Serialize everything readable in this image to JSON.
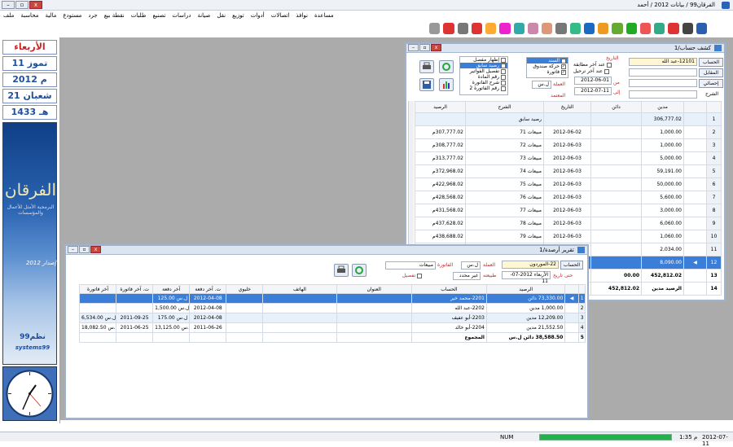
{
  "app": {
    "title": "الفرقان99 / بيانات 2012 / أحمد"
  },
  "window_buttons": {
    "close": "x",
    "restore": "▫",
    "min": "–"
  },
  "menu": [
    "ملف",
    "محاسبة",
    "مالية",
    "مستودع",
    "جرد",
    "نقطة بيع",
    "طلبات",
    "تصنيع",
    "دراسات",
    "صيانة",
    "نقل",
    "توزيع",
    "أدوات",
    "اتصالات",
    "نوافذ",
    "مساعدة"
  ],
  "sidebar": {
    "day": "الأربعاء",
    "greg_month": "11 تموز",
    "greg_year": "2012 م",
    "hijri_month": "21 شعبان",
    "hijri_year": "1433 هـ",
    "logo": "الفرقان",
    "logo_sub": "البرمجية الأمثل للأعمال والمؤسسات",
    "edition": "إصدار 2012",
    "sys_ar": "نظم99",
    "sys_en": "systems99"
  },
  "colors": {
    "accent": "#3b7ed8",
    "brand": "#1f4f9a",
    "alert": "#c1272d",
    "progress": "#23b14d"
  },
  "status": {
    "num": "NUM",
    "time": "1:35 م",
    "date": "2012-07-11",
    "progress_percent": 100
  },
  "account_statement": {
    "title": "كشف حساب/1",
    "account_label": "الحساب",
    "account_value": "12101-عبد الله",
    "counter_label": "المقابل",
    "stats_label": "إحصائي",
    "desc_label": "الشرح",
    "date_section": "التاريخ",
    "opt_match": "عند آخر مطابقة",
    "opt_transfer": "عند آخر ترحيل",
    "from_label": "من",
    "from_date": "2012-06-01",
    "to_label": "إلى",
    "to_date": "2012-07-11",
    "currency_label": "العملة",
    "currency_value": "ل.س",
    "approved_label": "المعتمد",
    "types": [
      {
        "label": "السند",
        "checked": true,
        "selected": true
      },
      {
        "label": "حركة صندوق",
        "checked": true
      },
      {
        "label": "فاتورة",
        "checked": true
      }
    ],
    "options": [
      {
        "label": "إظهار مفصل",
        "checked": false
      },
      {
        "label": "رصيد سابق",
        "checked": true,
        "selected": true
      },
      {
        "label": "تفصيل الفواتير",
        "checked": false
      },
      {
        "label": "رقم المادة",
        "checked": false
      },
      {
        "label": "شرح الفاتورة",
        "checked": false
      },
      {
        "label": "رقم الفاتورة 2",
        "checked": false
      }
    ],
    "columns": [
      "مدين",
      "دائن",
      "التاريخ",
      "الشرح",
      "الرصيد"
    ],
    "rows": [
      {
        "n": "1",
        "debit": "306,777.02",
        "credit": "",
        "date": "",
        "desc": "رصيد سابق",
        "balance": ""
      },
      {
        "n": "2",
        "debit": "1,000.00",
        "credit": "",
        "date": "2012-06-02",
        "desc": "مبيعات 71",
        "balance": "307,777.02م"
      },
      {
        "n": "3",
        "debit": "1,000.00",
        "credit": "",
        "date": "2012-06-03",
        "desc": "مبيعات 72",
        "balance": "308,777.02م"
      },
      {
        "n": "4",
        "debit": "5,000.00",
        "credit": "",
        "date": "2012-06-03",
        "desc": "مبيعات 73",
        "balance": "313,777.02م"
      },
      {
        "n": "5",
        "debit": "59,191.00",
        "credit": "",
        "date": "2012-06-03",
        "desc": "مبيعات 74",
        "balance": "372,968.02م"
      },
      {
        "n": "6",
        "debit": "50,000.00",
        "credit": "",
        "date": "2012-06-03",
        "desc": "مبيعات 75",
        "balance": "422,968.02م"
      },
      {
        "n": "7",
        "debit": "5,600.00",
        "credit": "",
        "date": "2012-06-03",
        "desc": "مبيعات 76",
        "balance": "428,568.02م"
      },
      {
        "n": "8",
        "debit": "3,000.00",
        "credit": "",
        "date": "2012-06-03",
        "desc": "مبيعات 77",
        "balance": "431,568.02م"
      },
      {
        "n": "9",
        "debit": "6,060.00",
        "credit": "",
        "date": "2012-06-03",
        "desc": "مبيعات 78",
        "balance": "437,628.02م"
      },
      {
        "n": "10",
        "debit": "1,060.00",
        "credit": "",
        "date": "2012-06-03",
        "desc": "مبيعات 79",
        "balance": "438,688.02م"
      },
      {
        "n": "11",
        "debit": "2,034.00",
        "credit": "",
        "date": "2012-06-03",
        "desc": "مبيعات 80",
        "balance": "440,722.02م"
      },
      {
        "n": "12",
        "debit": "8,090.00",
        "credit": "",
        "date": "2012-06-03",
        "desc": "مبيعات 81",
        "balance": "448,812.02م"
      }
    ],
    "total_row": {
      "n": "13",
      "debit": "452,812.02",
      "credit": "00.00",
      "label": "المجموع"
    },
    "balance_row": {
      "n": "14",
      "value": "452,812.02",
      "label": "الرصيد مدين"
    }
  },
  "balances_report": {
    "title": "تقرير أرصدة/1",
    "account_label": "الحساب",
    "account_value": "22-الموردون",
    "date_label": "حتى تاريخ",
    "date_weekday": "الأربعاء",
    "date_value": "2012-07-11",
    "currency_label": "العملة",
    "currency_value": "ل.س",
    "nature_label": "طبيعته",
    "nature_value": "غير محدد",
    "invoice_label": "الفاتورة",
    "invoice_value": "مبيعات",
    "detail_label": "تفصيل",
    "columns": [
      "الرصيد",
      "الحساب",
      "العنوان",
      "الهاتف",
      "خليوي",
      "ت. آخر دفعة",
      "آخر دفعة",
      "ت. آخر فاتورة",
      "آخر فاتورة"
    ],
    "rows": [
      {
        "n": "1",
        "balance": "73,330.00 دائن",
        "account": "2201-محمد خير",
        "addr": "",
        "phone": "",
        "mobile": "",
        "lp_date": "2012-04-08",
        "lp": "125.00 ل.س",
        "li_date": "",
        "li": ""
      },
      {
        "n": "2",
        "balance": "1,000.00 مدين",
        "account": "2202-عبد الله",
        "addr": "",
        "phone": "",
        "mobile": "",
        "lp_date": "2012-04-08",
        "lp": "1,500.00 ل.س",
        "li_date": "",
        "li": ""
      },
      {
        "n": "3",
        "balance": "12,209.00 مدين",
        "account": "2203-أبو عفيف",
        "addr": "",
        "phone": "",
        "mobile": "",
        "lp_date": "2012-04-08",
        "lp": "175.00 ل.س",
        "li_date": "2011-09-25",
        "li": "6,534.00 ل.س"
      },
      {
        "n": "4",
        "balance": "21,552.50 مدين",
        "account": "2204-أبو خالد",
        "addr": "",
        "phone": "",
        "mobile": "",
        "lp_date": "2011-06-26",
        "lp": "13,125.00 ل.س",
        "li_date": "2011-06-25",
        "li": "18,082.50 ل.س..."
      }
    ],
    "total": {
      "n": "5",
      "balance": "38,588.50 دائن ل.س",
      "label": "المجموع"
    }
  }
}
